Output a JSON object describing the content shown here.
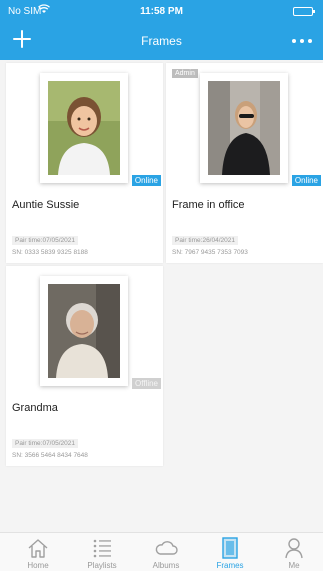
{
  "status_bar": {
    "carrier": "No SIM",
    "time": "11:58 PM"
  },
  "nav": {
    "title": "Frames",
    "add_icon": "plus-icon",
    "more_icon": "more-dots-icon"
  },
  "colors": {
    "accent": "#2aa3e4",
    "offline": "#d0d0d0",
    "admin": "#bdbdbd"
  },
  "frames": [
    {
      "name": "Auntie Sussie",
      "status": "Online",
      "admin": "",
      "pair_time": "Pair time:07/05/2021",
      "sn": "SN: 0333 5839 9325 8188"
    },
    {
      "name": "Frame in office",
      "status": "Online",
      "admin": "Admin",
      "pair_time": "Pair time:26/04/2021",
      "sn": "SN: 7967 9435 7353 7093"
    },
    {
      "name": "Grandma",
      "status": "Offline",
      "admin": "",
      "pair_time": "Pair time:07/05/2021",
      "sn": "SN: 3566 5464 8434 7648"
    }
  ],
  "tabbar": {
    "items": [
      {
        "label": "Home",
        "icon": "home-icon"
      },
      {
        "label": "Playlists",
        "icon": "list-icon"
      },
      {
        "label": "Albums",
        "icon": "cloud-icon"
      },
      {
        "label": "Frames",
        "icon": "frame-icon"
      },
      {
        "label": "Me",
        "icon": "person-icon"
      }
    ],
    "active_index": 3
  }
}
